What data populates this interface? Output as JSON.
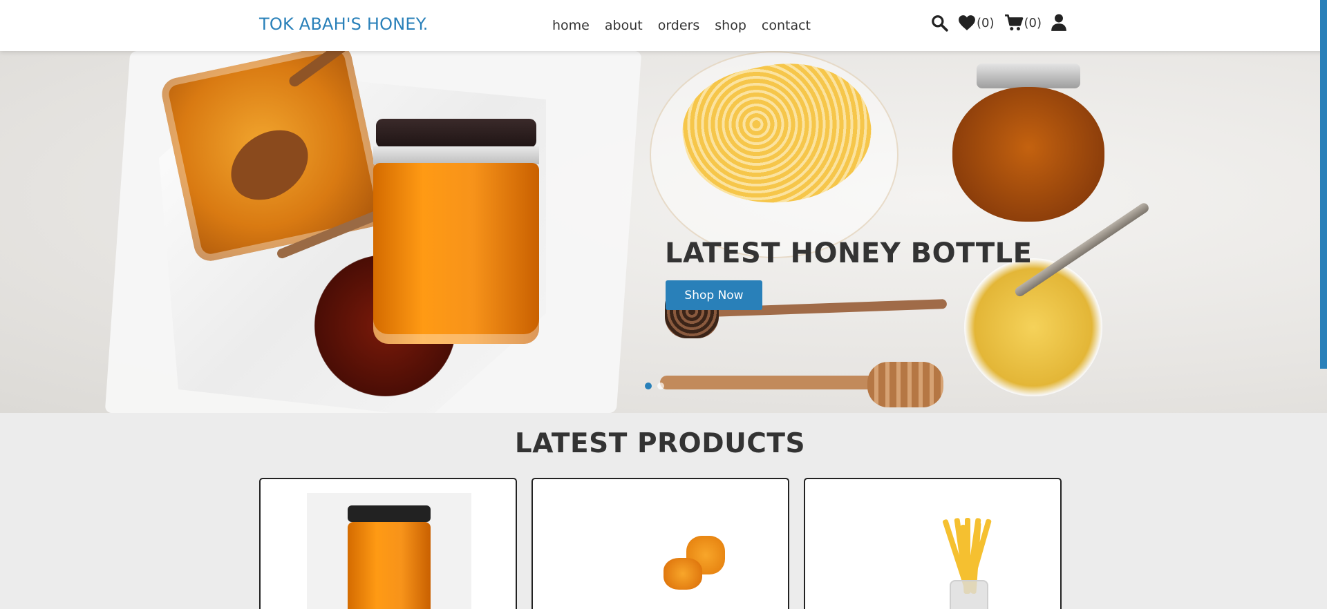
{
  "header": {
    "logo": "TOK ABAH'S HONEY.",
    "nav": [
      "home",
      "about",
      "orders",
      "shop",
      "contact"
    ],
    "wishlist_count": "(0)",
    "cart_count": "(0)",
    "accent_color": "#2980b9"
  },
  "hero": {
    "title": "LATEST HONEY BOTTLE",
    "button_label": "Shop Now",
    "slider_dots": 2,
    "active_dot": 0
  },
  "products": {
    "title": "LATEST PRODUCTS",
    "items": [
      {
        "image": "honey-jar-image"
      },
      {
        "image": "honey-candy-image"
      },
      {
        "image": "honey-sticks-image"
      }
    ]
  },
  "icons": [
    "search-icon",
    "heart-icon",
    "cart-icon",
    "user-icon"
  ]
}
